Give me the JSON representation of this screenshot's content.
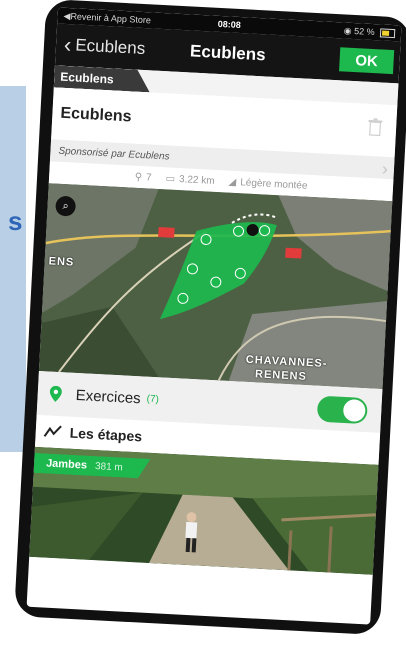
{
  "status_bar": {
    "back_to_app": "◀Revenir à App Store",
    "time": "08:08",
    "battery": "52 %"
  },
  "nav": {
    "back_label": "Ecublens",
    "title": "Ecublens",
    "ok_label": "OK"
  },
  "tag": "Ecublens",
  "route": {
    "name": "Ecublens",
    "sponsor": "Sponsorisé par Ecublens",
    "stats": {
      "points": "7",
      "distance": "3.22 km",
      "elevation": "Légère montée"
    }
  },
  "map": {
    "labels": [
      "ENS",
      "CHAVANNES-",
      "RENENS"
    ],
    "route_color": "#1db84e"
  },
  "exercises": {
    "label": "Exercices",
    "count": "(7)",
    "toggle_on": true
  },
  "steps": {
    "label": "Les étapes",
    "first": {
      "name": "Jambes",
      "distance": "381 m"
    }
  },
  "colors": {
    "accent": "#1db84e",
    "navbar": "#141414"
  }
}
